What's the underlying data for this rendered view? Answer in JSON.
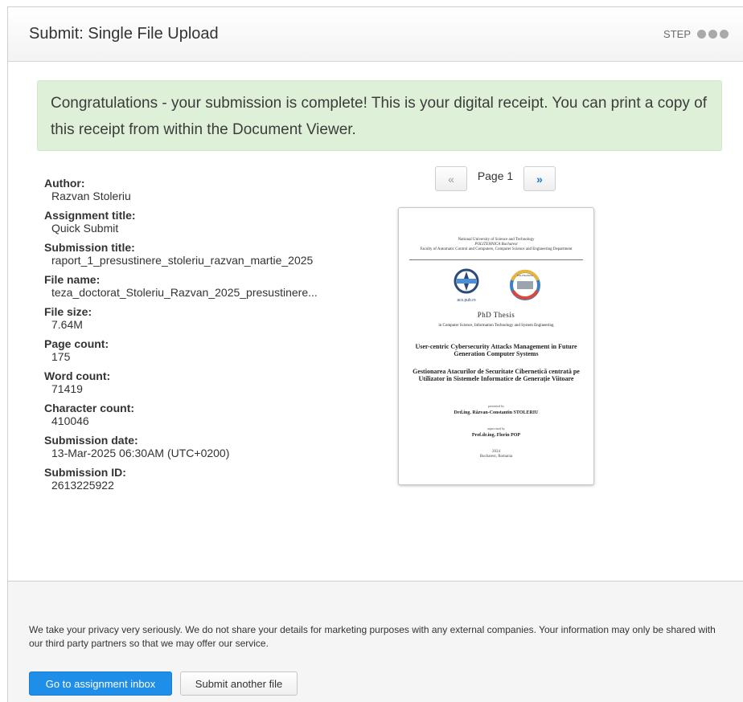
{
  "header": {
    "title": "Submit: Single File Upload",
    "step_label": "STEP",
    "step_dots": 3
  },
  "alert": {
    "message": "Congratulations - your submission is complete! This is your digital receipt. You can print a copy of this receipt from within the Document Viewer."
  },
  "receipt": [
    {
      "label": "Author:",
      "value": "Razvan Stoleriu"
    },
    {
      "label": "Assignment title:",
      "value": "Quick Submit"
    },
    {
      "label": "Submission title:",
      "value": "raport_1_presustinere_stoleriu_razvan_martie_2025"
    },
    {
      "label": "File name:",
      "value": "teza_doctorat_Stoleriu_Razvan_2025_presustinere..."
    },
    {
      "label": "File size:",
      "value": "7.64M"
    },
    {
      "label": "Page count:",
      "value": "175"
    },
    {
      "label": "Word count:",
      "value": "71419"
    },
    {
      "label": "Character count:",
      "value": "410046"
    },
    {
      "label": "Submission date:",
      "value": "13-Mar-2025 06:30AM (UTC+0200)"
    },
    {
      "label": "Submission ID:",
      "value": "2613225922"
    }
  ],
  "pager": {
    "prev_label": "«",
    "page_label": "Page 1",
    "next_label": "»"
  },
  "document": {
    "university_line1": "National University of Science and Technology",
    "university_line2": "POLITEHNICA Bucharest",
    "university_line3": "Faculty of Automatic Control and Computers, Computer Science and Engineering Department",
    "logo_left_caption": "acs.pub.ro",
    "logo_right_caption": "POLITEHNICA",
    "thesis_label": "PhD Thesis",
    "field": "in Computer Science, Information Technology and System Engineering",
    "title_en": "User-centric Cybersecurity Attacks Management in Future Generation Computer Systems",
    "title_ro": "Gestionarea Atacurilor de Securitate Cibernetică centrată pe Utilizator în Sistemele Informatice de Generație Viitoare",
    "presented_by": "presented by",
    "author": "Drd.ing. Răzvan-Constantin STOLERIU",
    "supervised_by": "supervised by",
    "supervisor": "Prof.dr.ing. Florin POP",
    "year": "2024",
    "city": "Bucharest, Romania"
  },
  "footer": {
    "privacy": "We take your privacy very seriously. We do not share your details for marketing purposes with any external companies. Your information may only be shared with our third party partners so that we may offer our service.",
    "primary_button": "Go to assignment inbox",
    "secondary_button": "Submit another file"
  },
  "colors": {
    "alert_bg": "#dff0d8",
    "primary_button": "#1f8ee8",
    "link_blue": "#1a73d9"
  }
}
